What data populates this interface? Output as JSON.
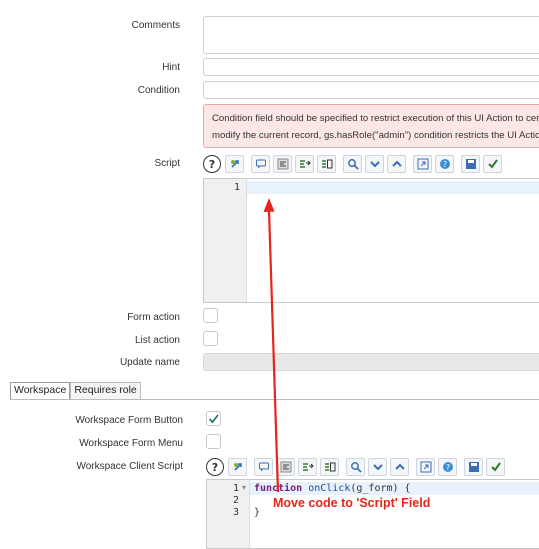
{
  "form": {
    "comments_label": "Comments",
    "hint_label": "Hint",
    "condition_label": "Condition",
    "condition_alert": {
      "line1": "Condition field should be specified to restrict execution of this UI Action to cer",
      "line2": "modify the current record, gs.hasRole(\"admin\") condition restricts the UI Actio"
    },
    "script_label": "Script",
    "script_editor": {
      "line_numbers": [
        "1"
      ]
    },
    "form_action_label": "Form action",
    "list_action_label": "List action",
    "update_name_label": "Update name",
    "form_action_checked": false,
    "list_action_checked": false
  },
  "tabs": [
    {
      "label": "Workspace",
      "active": true
    },
    {
      "label": "Requires role",
      "active": false
    }
  ],
  "workspace": {
    "form_button_label": "Workspace Form Button",
    "form_button_checked": true,
    "form_menu_label": "Workspace Form Menu",
    "form_menu_checked": false,
    "client_script_label": "Workspace Client Script",
    "client_script_editor": {
      "line_numbers": [
        "1",
        "2",
        "3"
      ],
      "fold_marker": "▾",
      "code": {
        "keyword": "function",
        "func_name": "onClick",
        "params": "(g_form) {",
        "closing": "}"
      }
    }
  },
  "toolbar_icons": [
    "help-icon",
    "script-include-icon",
    "comment-icon",
    "format-icon",
    "replace-icon",
    "replace-all-icon",
    "search-icon",
    "fold-down-icon",
    "fold-up-icon",
    "fullscreen-icon",
    "info-icon",
    "save-icon",
    "validate-icon"
  ],
  "help_glyph": "?",
  "annotation": {
    "text": "Move code to 'Script' Field",
    "color": "#e8231b"
  }
}
